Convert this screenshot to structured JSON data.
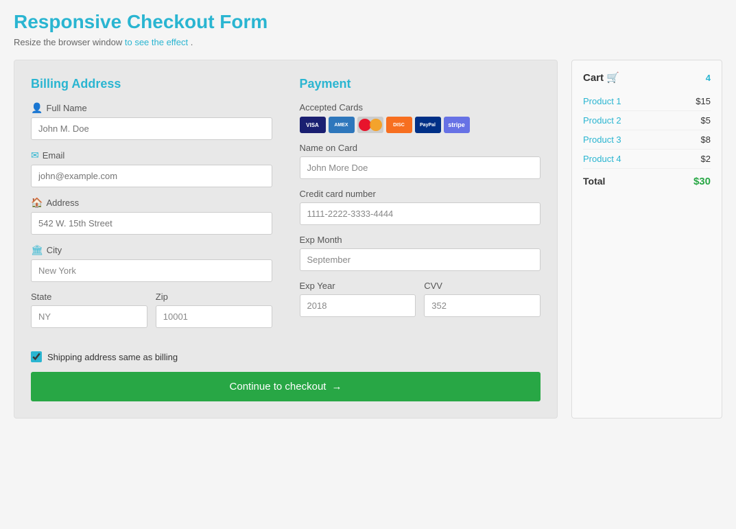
{
  "header": {
    "title": "Responsive Checkout Form",
    "subtitle": "Resize the browser window",
    "subtitle_link": "to see the effect",
    "subtitle_end": "."
  },
  "billing": {
    "title": "Billing Address",
    "fields": {
      "full_name_label": "Full Name",
      "full_name_placeholder": "John M. Doe",
      "email_label": "Email",
      "email_placeholder": "john@example.com",
      "address_label": "Address",
      "address_placeholder": "542 W. 15th Street",
      "city_label": "City",
      "city_value": "New York",
      "state_label": "State",
      "state_value": "NY",
      "zip_label": "Zip",
      "zip_value": "10001"
    }
  },
  "payment": {
    "title": "Payment",
    "accepted_cards_label": "Accepted Cards",
    "cards": [
      "VISA",
      "AMEX",
      "MC",
      "DISC",
      "PP",
      "stripe"
    ],
    "fields": {
      "name_on_card_label": "Name on Card",
      "name_on_card_value": "John More Doe",
      "credit_card_label": "Credit card number",
      "credit_card_value": "1111-2222-3333-4444",
      "exp_month_label": "Exp Month",
      "exp_month_value": "September",
      "exp_year_label": "Exp Year",
      "exp_year_value": "2018",
      "cvv_label": "CVV",
      "cvv_value": "352"
    }
  },
  "checkout": {
    "shipping_label": "Shipping address same as billing",
    "button_label": "Continue to checkout",
    "button_arrow": "→"
  },
  "cart": {
    "title": "Cart",
    "cart_icon": "🛒",
    "count": "4",
    "items": [
      {
        "name": "Product 1",
        "price": "$15"
      },
      {
        "name": "Product 2",
        "price": "$5"
      },
      {
        "name": "Product 3",
        "price": "$8"
      },
      {
        "name": "Product 4",
        "price": "$2"
      }
    ],
    "total_label": "Total",
    "total_value": "$30"
  }
}
